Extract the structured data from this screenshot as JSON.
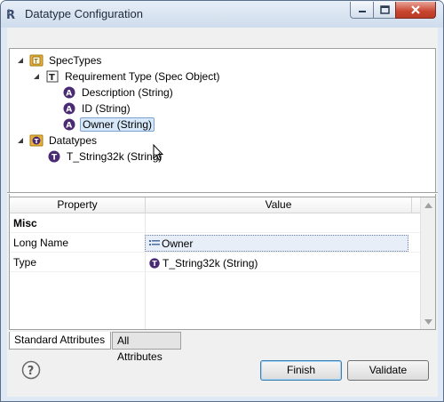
{
  "window": {
    "title": "Datatype Configuration"
  },
  "tree": {
    "items": [
      {
        "label": "SpecTypes",
        "icon": "spectypes-folder-icon",
        "expanded": true
      },
      {
        "label": "Requirement Type (Spec Object)",
        "icon": "requirement-type-icon",
        "expanded": true
      },
      {
        "label": "Description (String)",
        "icon": "attribute-icon"
      },
      {
        "label": "ID (String)",
        "icon": "attribute-icon"
      },
      {
        "label": "Owner (String)",
        "icon": "attribute-icon",
        "selected": true
      },
      {
        "label": "Datatypes",
        "icon": "datatypes-folder-icon",
        "expanded": true
      },
      {
        "label": "T_String32k (String)",
        "icon": "datatype-icon"
      }
    ]
  },
  "properties": {
    "columns": [
      "Property",
      "Value"
    ],
    "category": "Misc",
    "rows": [
      {
        "name": "Long Name",
        "value": "Owner",
        "icon": "text-value-icon"
      },
      {
        "name": "Type",
        "value": "T_String32k (String)",
        "icon": "datatype-icon"
      }
    ]
  },
  "tabs": [
    {
      "label": "Standard Attributes",
      "active": true
    },
    {
      "label": "All Attributes",
      "active": false
    }
  ],
  "buttons": {
    "finish": "Finish",
    "validate": "Validate"
  },
  "colors": {
    "attribute_icon": "#4a2a73",
    "folder_icon": "#e8b23a",
    "selection": "#d6e8fa",
    "close_button": "#c8452f"
  }
}
